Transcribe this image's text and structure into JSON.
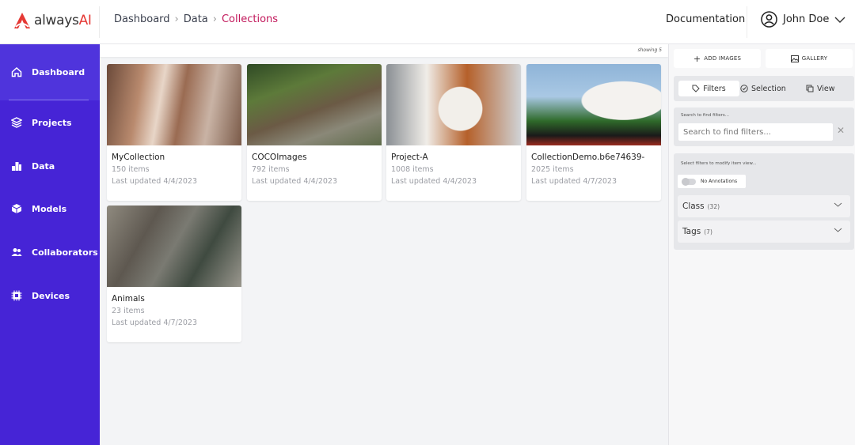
{
  "header": {
    "logo": "alwaysAI",
    "breadcrumb": [
      "Dashboard",
      "Data",
      "Collections"
    ],
    "documentation": "Documentation",
    "user": "John Doe"
  },
  "sidebar": {
    "items": [
      {
        "label": "Dashboard",
        "icon": "home-icon"
      },
      {
        "label": "Projects",
        "icon": "layers-icon"
      },
      {
        "label": "Data",
        "icon": "data-blocks-icon"
      },
      {
        "label": "Models",
        "icon": "cube-icon"
      },
      {
        "label": "Collaborators",
        "icon": "users-icon"
      },
      {
        "label": "Devices",
        "icon": "chip-icon"
      }
    ],
    "color": "#4624d6"
  },
  "main": {
    "showing": "showing 5",
    "collections": [
      {
        "name": "MyCollection",
        "items": "150 items",
        "updated": "Last updated 4/4/2023"
      },
      {
        "name": "COCOImages",
        "items": "792 items",
        "updated": "Last updated 4/4/2023"
      },
      {
        "name": "Project-A",
        "items": "1008 items",
        "updated": "Last updated 4/4/2023"
      },
      {
        "name": "CollectionDemo.b6e74639-",
        "items": "2025 items",
        "updated": "Last updated 4/7/2023"
      },
      {
        "name": "Animals",
        "items": "23 items",
        "updated": "Last updated 4/7/2023"
      }
    ]
  },
  "panel": {
    "add_images": "ADD IMAGES",
    "gallery": "GALLERY",
    "tabs": [
      "Filters",
      "Selection",
      "View"
    ],
    "search_label": "Search to find filters...",
    "search_placeholder": "Search to find filters...",
    "filters_label": "Select filters to modify item view...",
    "no_annotations": "No Annotations",
    "class_label": "Class",
    "class_count": "(32)",
    "tags_label": "Tags",
    "tags_count": "(7)"
  }
}
